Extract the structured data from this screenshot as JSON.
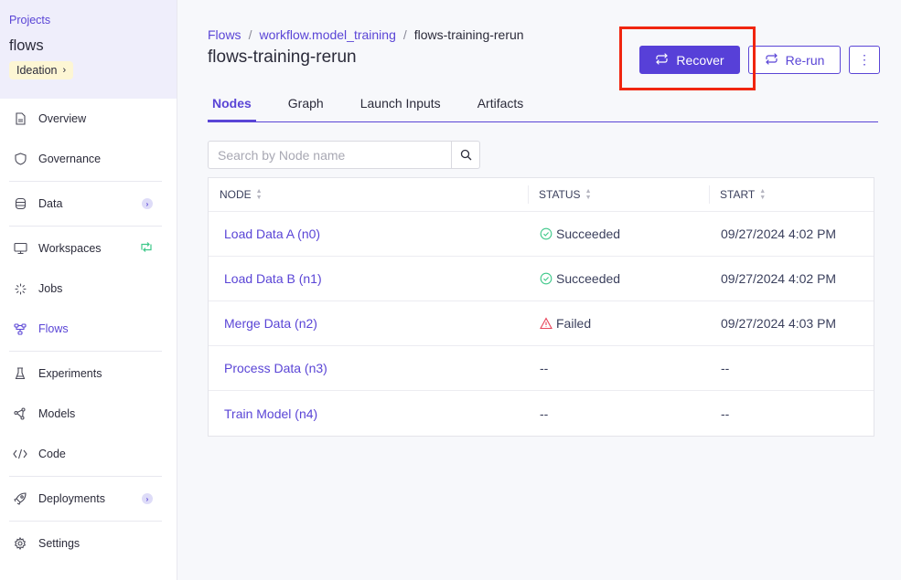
{
  "sidebar": {
    "projects_link": "Projects",
    "project_name": "flows",
    "stage_badge": "Ideation",
    "items": [
      {
        "label": "Overview",
        "icon": "document-icon"
      },
      {
        "label": "Governance",
        "icon": "shield-icon"
      },
      {
        "label": "Data",
        "icon": "database-icon",
        "trail": "chevron-right-icon"
      },
      {
        "label": "Workspaces",
        "icon": "monitor-icon",
        "trail": "sync-icon"
      },
      {
        "label": "Jobs",
        "icon": "spinner-icon"
      },
      {
        "label": "Flows",
        "icon": "flow-icon",
        "active": true
      },
      {
        "label": "Experiments",
        "icon": "flask-icon"
      },
      {
        "label": "Models",
        "icon": "model-icon"
      },
      {
        "label": "Code",
        "icon": "code-icon"
      },
      {
        "label": "Deployments",
        "icon": "rocket-icon",
        "trail": "chevron-right-icon"
      },
      {
        "label": "Settings",
        "icon": "gear-icon"
      }
    ]
  },
  "header": {
    "breadcrumb": [
      "Flows",
      "workflow.model_training",
      "flows-training-rerun"
    ],
    "title": "flows-training-rerun",
    "recover_label": "Recover",
    "rerun_label": "Re-run",
    "more_label": "⋮"
  },
  "tabs": [
    {
      "label": "Nodes",
      "active": true
    },
    {
      "label": "Graph"
    },
    {
      "label": "Launch Inputs"
    },
    {
      "label": "Artifacts"
    }
  ],
  "search": {
    "placeholder": "Search by Node name",
    "value": ""
  },
  "table": {
    "columns": [
      "NODE",
      "STATUS",
      "START"
    ],
    "rows": [
      {
        "node": "Load Data A (n0)",
        "status": "Succeeded",
        "status_type": "success",
        "start": "09/27/2024 4:02 PM"
      },
      {
        "node": "Load Data B (n1)",
        "status": "Succeeded",
        "status_type": "success",
        "start": "09/27/2024 4:02 PM"
      },
      {
        "node": "Merge Data (n2)",
        "status": "Failed",
        "status_type": "failed",
        "start": "09/27/2024 4:03 PM"
      },
      {
        "node": "Process Data (n3)",
        "status": "--",
        "status_type": "none",
        "start": "--"
      },
      {
        "node": "Train Model (n4)",
        "status": "--",
        "status_type": "none",
        "start": "--"
      }
    ]
  },
  "colors": {
    "accent": "#5740d8",
    "success": "#3ec88a",
    "failed": "#e8455b",
    "highlight": "#f0250f"
  }
}
